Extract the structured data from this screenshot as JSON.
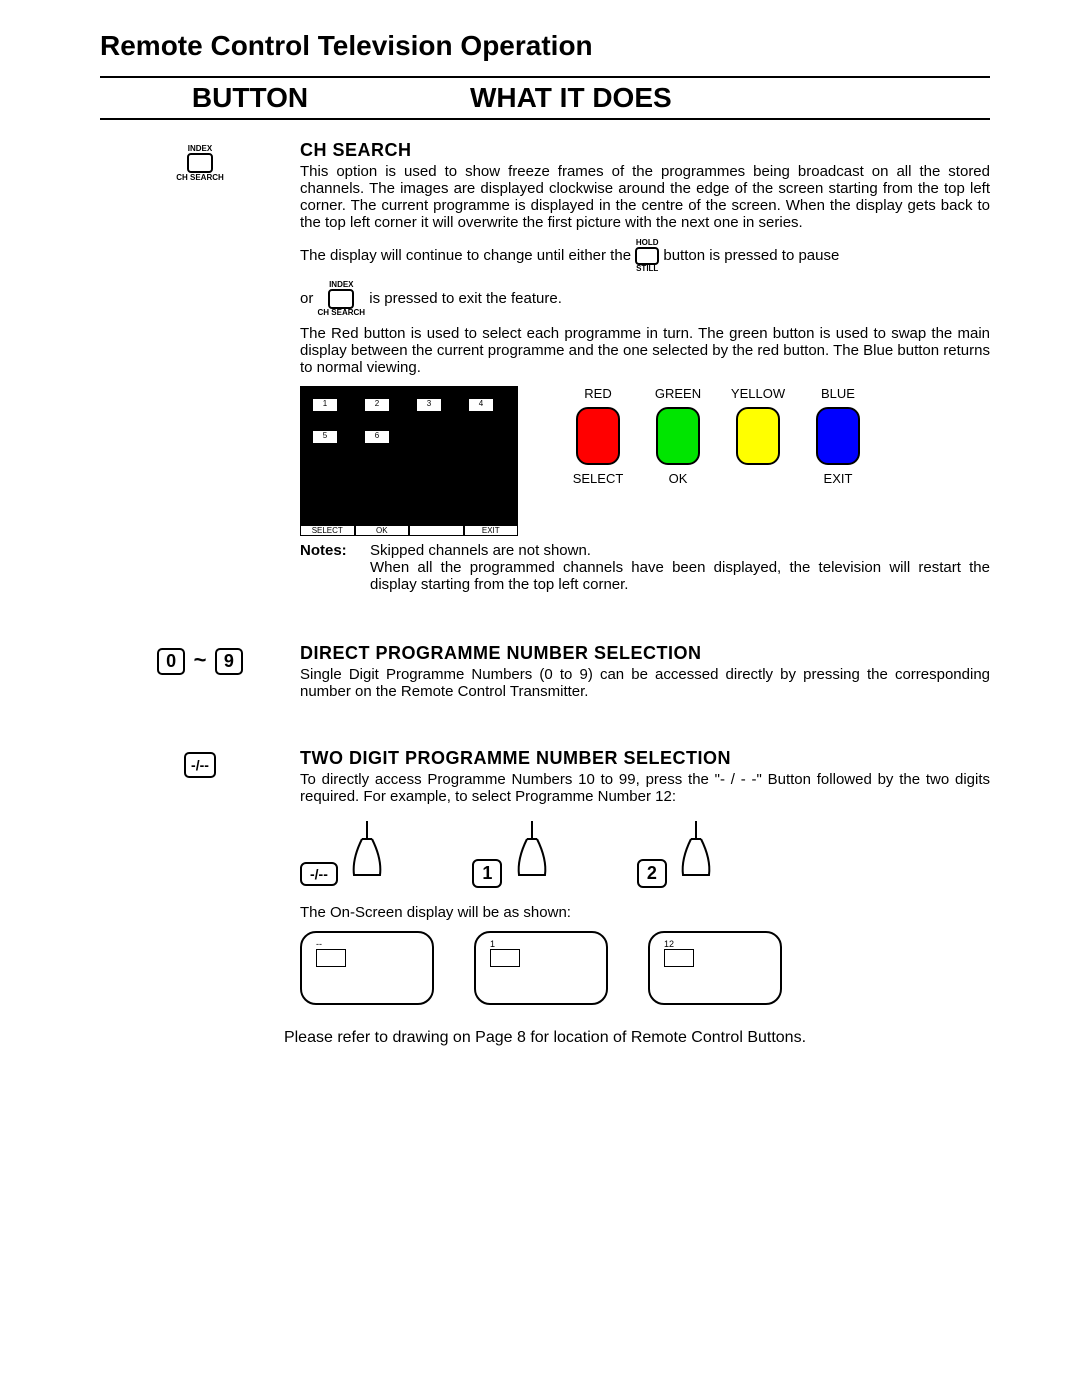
{
  "page_title": "Remote Control Television Operation",
  "header": {
    "button": "BUTTON",
    "what": "WHAT IT DOES"
  },
  "ch_search": {
    "icon_top": "INDEX",
    "icon_bottom": "CH SEARCH",
    "heading": "CH SEARCH",
    "p1": "This option is used to show freeze frames of the programmes being broadcast on all the stored channels. The images are displayed clockwise around the edge of the screen starting from the top left corner. The current programme is displayed in the centre of the screen. When the display gets back to the top left corner it will overwrite the first picture with the next one in series.",
    "p2a": "The display will continue to change until either the ",
    "p2_hold_top": "HOLD",
    "p2_hold_bot": "STILL",
    "p2b": " button is pressed to pause",
    "p3a": "or ",
    "p3b": " is pressed to exit the feature.",
    "p4": "The Red button is used to select each programme in turn. The green button is used to swap the main display between the current programme and the one selected by the red button. The Blue button returns to normal viewing.",
    "preview_thumbs": [
      "1",
      "2",
      "3",
      "4",
      "5",
      "6"
    ],
    "preview_footer": [
      "SELECT",
      "OK",
      "",
      "EXIT"
    ],
    "colors": [
      {
        "top": "RED",
        "hex": "#ff0000",
        "bot": "SELECT"
      },
      {
        "top": "GREEN",
        "hex": "#00e500",
        "bot": "OK"
      },
      {
        "top": "YELLOW",
        "hex": "#ffff00",
        "bot": ""
      },
      {
        "top": "BLUE",
        "hex": "#0000ff",
        "bot": "EXIT"
      }
    ],
    "notes_label": "Notes:",
    "notes_text": "Skipped channels are not shown.\nWhen all the programmed channels have been displayed, the television will restart the display starting from the top left corner."
  },
  "direct": {
    "key0": "0",
    "tilde": "~",
    "key9": "9",
    "heading": "DIRECT PROGRAMME NUMBER SELECTION",
    "p1": "Single Digit Programme Numbers (0 to 9) can be accessed directly by pressing the corresponding number on the Remote Control Transmitter."
  },
  "twodigit": {
    "key": "-/--",
    "heading": "TWO DIGIT PROGRAMME NUMBER SELECTION",
    "p1": "To directly access Programme Numbers 10 to 99, press the \"- / - -\" Button followed by the two digits required. For example, to select Programme Number 12:",
    "hands": [
      "-/--",
      "1",
      "2"
    ],
    "p2": "The On-Screen display will be as shown:",
    "osd": [
      "--",
      "1",
      "12"
    ]
  },
  "footer": "Please refer to drawing on Page 8 for location of Remote Control Buttons."
}
